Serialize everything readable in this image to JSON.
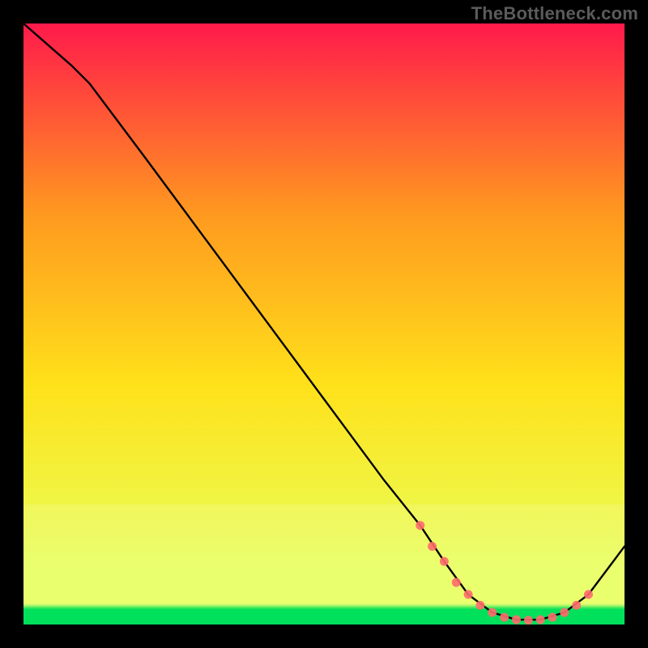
{
  "watermark": "TheBottleneck.com",
  "chart_data": {
    "type": "line",
    "title": "",
    "xlabel": "",
    "ylabel": "",
    "xlim": [
      0,
      100
    ],
    "ylim": [
      0,
      100
    ],
    "background_gradient": {
      "top": "#ff1a4b",
      "upper_mid": "#ff9a1f",
      "mid": "#ffe11a",
      "lower": "#e8ff5a",
      "bottom": "#00e05a"
    },
    "series": [
      {
        "name": "curve",
        "color": "#000000",
        "x": [
          0,
          8,
          11,
          20,
          30,
          40,
          50,
          60,
          66,
          70,
          74,
          78,
          82,
          86,
          90,
          94,
          100
        ],
        "values": [
          100,
          93,
          90,
          78,
          64.5,
          51,
          37.5,
          24,
          16.5,
          10.5,
          5,
          2,
          0.8,
          0.8,
          2,
          5,
          13
        ]
      }
    ],
    "markers": {
      "color": "#ff6b6b",
      "x": [
        66,
        68,
        70,
        72,
        74,
        76,
        78,
        80,
        82,
        84,
        86,
        88,
        90,
        92,
        94
      ],
      "values": [
        16.5,
        13,
        10.5,
        7,
        5,
        3.2,
        2,
        1.2,
        0.8,
        0.7,
        0.8,
        1.2,
        2,
        3.2,
        5
      ]
    }
  }
}
